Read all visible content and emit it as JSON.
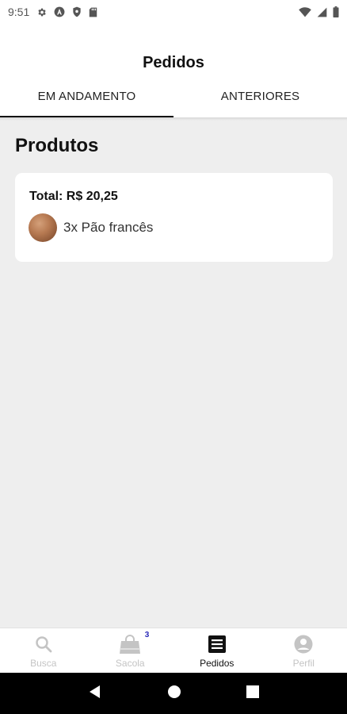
{
  "status_bar": {
    "time": "9:51",
    "left_icons": [
      "settings-icon",
      "a-icon",
      "shield-icon",
      "sd-card-icon"
    ],
    "right_icons": [
      "wifi-icon",
      "signal-icon",
      "battery-icon"
    ]
  },
  "header": {
    "title": "Pedidos",
    "tabs": [
      {
        "label": "EM ANDAMENTO",
        "active": true
      },
      {
        "label": "ANTERIORES",
        "active": false
      }
    ]
  },
  "main": {
    "section_title": "Produtos",
    "order": {
      "total": "Total: R$ 20,25",
      "items": [
        {
          "label": "3x Pão francês",
          "thumb": "bread-roll-image"
        }
      ]
    }
  },
  "bottom_nav": {
    "items": [
      {
        "label": "Busca",
        "icon": "search-icon",
        "active": false
      },
      {
        "label": "Sacola",
        "icon": "bag-icon",
        "badge": "3",
        "active": false
      },
      {
        "label": "Pedidos",
        "icon": "list-icon",
        "active": true
      },
      {
        "label": "Perfil",
        "icon": "person-icon",
        "active": false
      }
    ]
  },
  "system_nav": [
    "back-icon",
    "home-icon",
    "recents-icon"
  ],
  "colors": {
    "background": "#eeeeee",
    "card": "#ffffff",
    "active": "#111111",
    "inactive": "#c4c4c4",
    "badge": "#2a2ab8"
  }
}
